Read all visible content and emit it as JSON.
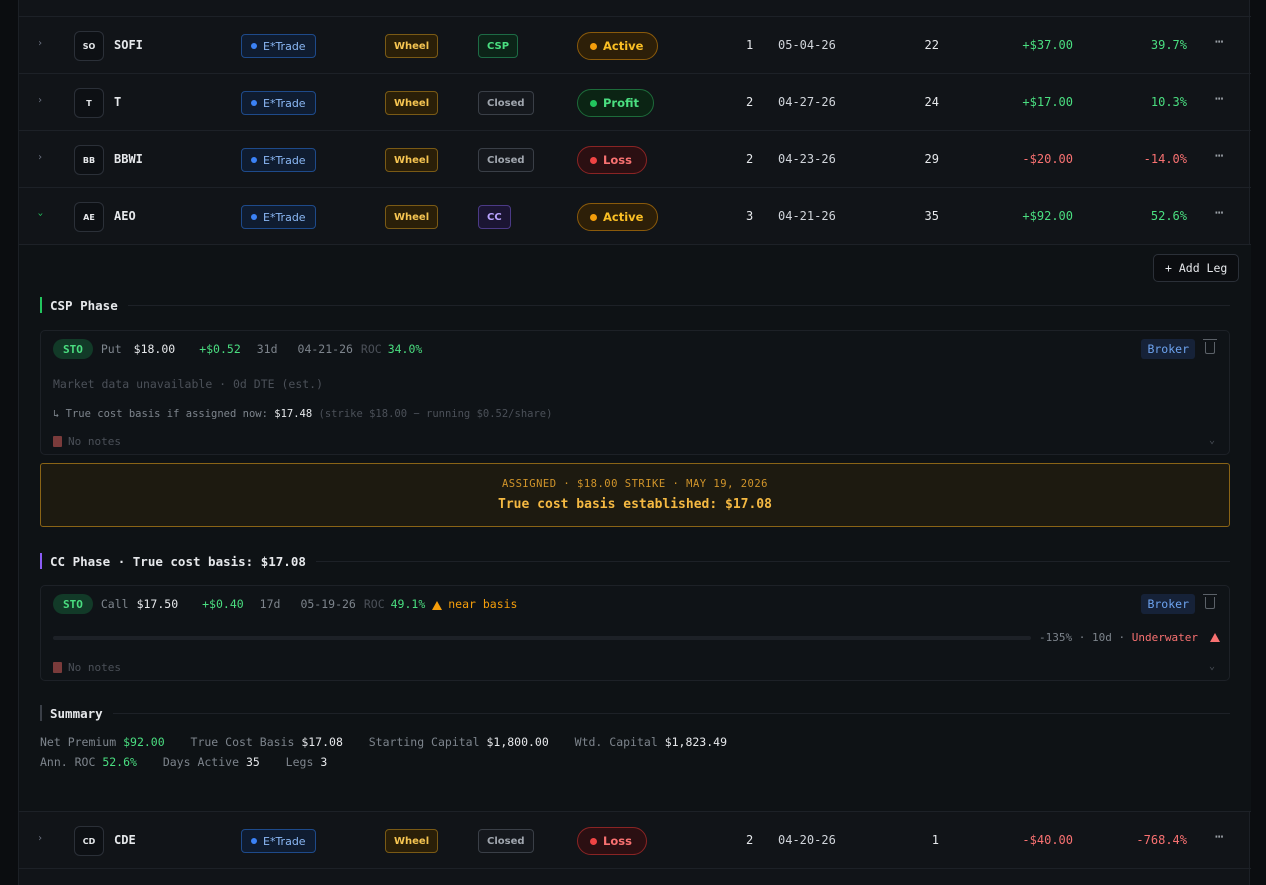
{
  "rows": [
    {
      "expand": "›",
      "initials": "SO",
      "ticker": "SOFI",
      "broker": "E*Trade",
      "strategy": "Wheel",
      "phase": "CSP",
      "status": "Active",
      "legs": "1",
      "date": "05-04-26",
      "days": "22",
      "pnl": "+$37.00",
      "roc": "39.7%"
    },
    {
      "expand": "›",
      "initials": "T",
      "ticker": "T",
      "broker": "E*Trade",
      "strategy": "Wheel",
      "phase": "Closed",
      "status": "Profit",
      "legs": "2",
      "date": "04-27-26",
      "days": "24",
      "pnl": "+$17.00",
      "roc": "10.3%"
    },
    {
      "expand": "›",
      "initials": "BB",
      "ticker": "BBWI",
      "broker": "E*Trade",
      "strategy": "Wheel",
      "phase": "Closed",
      "status": "Loss",
      "legs": "2",
      "date": "04-23-26",
      "days": "29",
      "pnl": "-$20.00",
      "roc": "-14.0%"
    },
    {
      "expand": "›",
      "initials": "AE",
      "ticker": "AEO",
      "broker": "E*Trade",
      "strategy": "Wheel",
      "phase": "CC",
      "status": "Active",
      "legs": "3",
      "date": "04-21-26",
      "days": "35",
      "pnl": "+$92.00",
      "roc": "52.6%"
    },
    {
      "expand": "›",
      "initials": "CD",
      "ticker": "CDE",
      "broker": "E*Trade",
      "strategy": "Wheel",
      "phase": "Closed",
      "status": "Loss",
      "legs": "2",
      "date": "04-20-26",
      "days": "1",
      "pnl": "-$40.00",
      "roc": "-768.4%"
    }
  ],
  "more_icon": "⋯",
  "detail": {
    "add_leg": "+ Add Leg",
    "csp_title": "CSP Phase",
    "csp_leg": {
      "action": "STO",
      "type": "Put",
      "strike": "$18.00",
      "premium": "+$0.52",
      "dte": "31d",
      "date": "04-21-26",
      "roc_label": "ROC",
      "roc": "34.0%",
      "broker": "Broker",
      "market": "Market data unavailable · 0d DTE (est.)",
      "basis_prefix": "↳ True cost basis if assigned now:",
      "basis_value": "$17.48",
      "basis_note": "(strike $18.00 − running $0.52/share)",
      "notes": "No notes"
    },
    "assigned_line1": "ASSIGNED · $18.00 STRIKE · MAY 19, 2026",
    "assigned_line2": "True cost basis established: $17.08",
    "cc_title": "CC Phase · True cost basis: $17.08",
    "cc_leg": {
      "action": "STO",
      "type": "Call",
      "strike": "$17.50",
      "premium": "+$0.40",
      "dte": "17d",
      "date": "05-19-26",
      "roc_label": "ROC",
      "roc": "49.1%",
      "warning": "near basis",
      "broker": "Broker",
      "progress_pct": "-135%",
      "progress_days": "10d",
      "progress_state": "Underwater",
      "notes": "No notes"
    },
    "summary_title": "Summary",
    "summary": {
      "net_premium_label": "Net Premium",
      "net_premium": "$92.00",
      "true_cost_label": "True Cost Basis",
      "true_cost": "$17.08",
      "starting_capital_label": "Starting Capital",
      "starting_capital": "$1,800.00",
      "wtd_capital_label": "Wtd. Capital",
      "wtd_capital": "$1,823.49",
      "ann_roc_label": "Ann. ROC",
      "ann_roc": "52.6%",
      "days_active_label": "Days Active",
      "days_active": "35",
      "legs_label": "Legs",
      "legs": "3"
    }
  },
  "colors": {
    "accent_green": "#4ade80",
    "accent_amber": "#f59e0b",
    "accent_red": "#f87171",
    "cc_purple": "#8b5cf6",
    "csp_green": "#22c55e"
  }
}
